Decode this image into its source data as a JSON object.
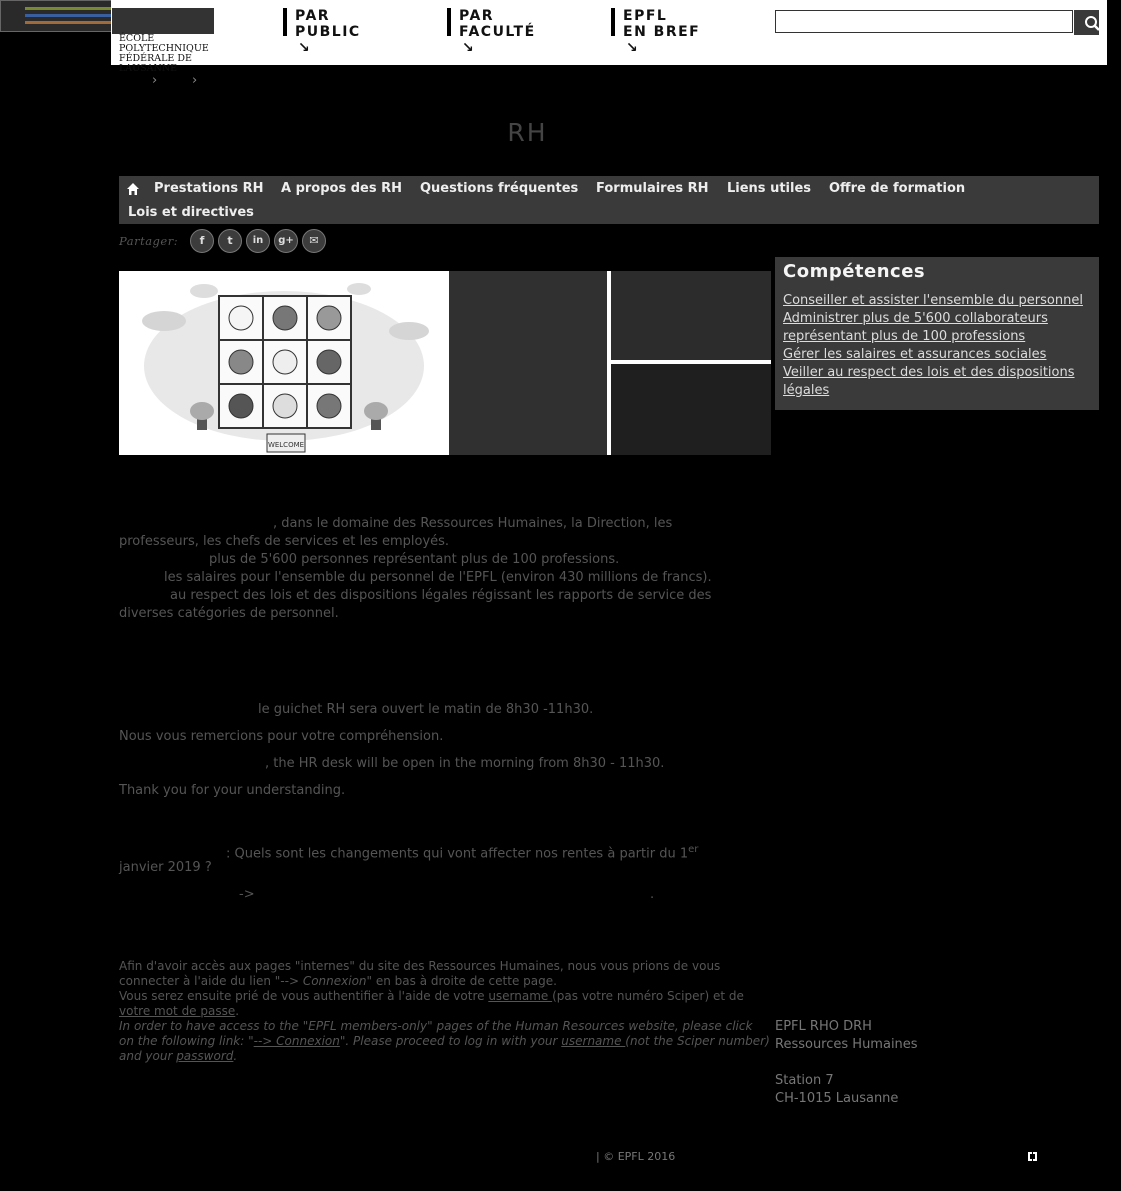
{
  "header": {
    "logo_lines": [
      "ÉCOLE POLYTECHNIQUE",
      "FÉDÉRALE DE LAUSANNE"
    ],
    "nav": [
      {
        "line1": "PAR",
        "line2": "PUBLIC"
      },
      {
        "line1": "PAR",
        "line2": "FACULTÉ"
      },
      {
        "line1": "EPFL",
        "line2": "EN BREF"
      }
    ],
    "search_value": ""
  },
  "breadcrumb": {
    "separators": [
      "›",
      "›"
    ]
  },
  "page_title": "RH",
  "menu": {
    "items": [
      "Prestations RH",
      "A propos des RH",
      "Questions fréquentes",
      "Formulaires RH",
      "Liens utiles",
      "Offre de formation",
      "Lois et directives"
    ]
  },
  "share": {
    "label": "Partager:",
    "buttons": [
      "f",
      "t",
      "in",
      "g+",
      "✉"
    ]
  },
  "banner": {
    "sign": "WELCOME"
  },
  "competences": {
    "title": "Compétences",
    "links": [
      "Conseiller et assister l'ensemble du personnel",
      "Administrer plus de 5'600 collaborateurs",
      "représentant plus de 100 professions",
      "Gérer les salaires et assurances sociales",
      "Veiller au respect des lois et des dispositions",
      "légales"
    ]
  },
  "intro": {
    "p1": ", dans le domaine des Ressources Humaines, la Direction, les",
    "p2": "professeurs, les chefs de services et les employés.",
    "p3": "plus de 5'600 personnes représentant plus de 100 professions.",
    "p4": "les salaires pour l'ensemble du personnel de l'EPFL (environ 430 millions de francs).",
    "p5": "au respect des lois et des dispositions légales régissant les rapports de service des",
    "p6": "diverses catégories de personnel."
  },
  "notice": {
    "fr": "le guichet RH sera ouvert le matin de 8h30 -11h30.",
    "fr_thanks": "Nous vous remercions pour votre compréhension.",
    "en": ", the HR desk will be open in the morning from 8h30 - 11h30.",
    "en_thanks": "Thank you for your understanding."
  },
  "pension": {
    "line1": ": Quels sont les changements qui vont affecter nos rentes à partir du 1",
    "sup": "er",
    "line2": "janvier 2019 ?",
    "arrow": "->",
    "dot": "."
  },
  "login_info": {
    "fr1": "Afin d'avoir accès aux pages \"internes\" du site des Ressources Humaines, nous vous prions de vous",
    "fr2a": "connecter à l'aide du lien \"",
    "fr2b": "--> Connexion",
    "fr2c": "\" en bas à droite de cette page.",
    "fr3a": "Vous serez ensuite prié de vous authentifier à l'aide de votre ",
    "fr3b": "username ",
    "fr3c": "(pas votre numéro Sciper) et de",
    "fr4a": "votre mot de passe",
    "fr4b": ".",
    "en1": "In order to have access to the \"EPFL members-only\" pages of the Human Resources website, please click",
    "en2a": "on the following link: \"",
    "en2b": "--> Connexion",
    "en2c": "\". Please proceed to log in with your ",
    "en2d": "username ",
    "en2e": "(not the Sciper number)",
    "en3a": "and your ",
    "en3b": "password",
    "en3c": "."
  },
  "address": {
    "l1": "EPFL RHO DRH",
    "l2": "Ressources Humaines",
    "l3": "Station 7",
    "l4": "CH-1015 Lausanne"
  },
  "footer": {
    "copyright": "| © EPFL 2016"
  }
}
